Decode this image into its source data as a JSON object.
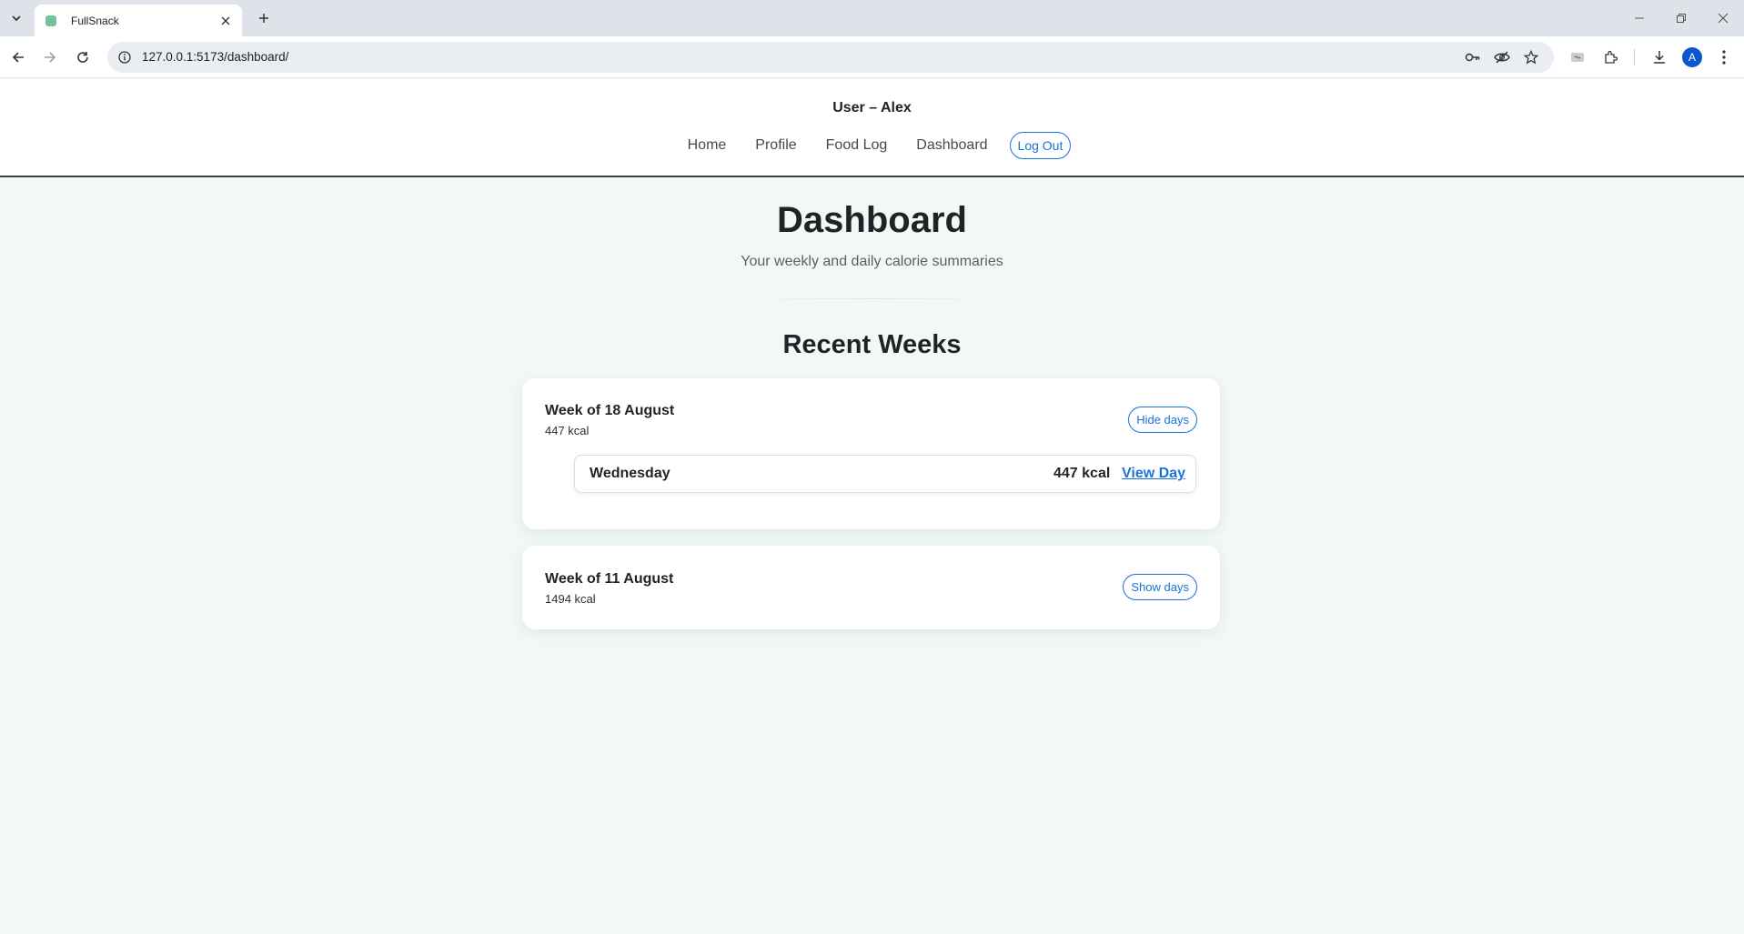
{
  "browser": {
    "tab_title": "FullSnack",
    "url": "127.0.0.1:5173/dashboard/",
    "profile_initial": "A"
  },
  "header": {
    "user_title": "User – Alex",
    "nav": {
      "home": "Home",
      "profile": "Profile",
      "food_log": "Food Log",
      "dashboard": "Dashboard",
      "logout": "Log Out"
    }
  },
  "main": {
    "title": "Dashboard",
    "subtitle": "Your weekly and daily calorie summaries",
    "section_title": "Recent Weeks",
    "weeks": [
      {
        "title": "Week of 18 August",
        "kcal": "447 kcal",
        "toggle_label": "Hide days",
        "expanded": true,
        "days": [
          {
            "name": "Wednesday",
            "kcal": "447 kcal",
            "link_label": "View Day"
          }
        ]
      },
      {
        "title": "Week of 11 August",
        "kcal": "1494 kcal",
        "toggle_label": "Show days",
        "expanded": false,
        "days": []
      }
    ]
  },
  "colors": {
    "accent": "#1a73d9",
    "page_background": "#f2f8f4",
    "header_rule": "#3a3f44"
  }
}
